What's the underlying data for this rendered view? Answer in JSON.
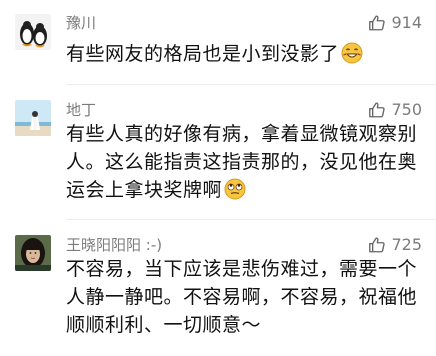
{
  "comments": [
    {
      "username": "豫川",
      "likes": "914",
      "text": "有些网友的格局也是小到没影了",
      "emoji": "grin-emoji"
    },
    {
      "username": "地丁",
      "likes": "750",
      "text": "有些人真的好像有病，拿着显微镜观察别人。这么能指责这指责那的，没见他在奥运会上拿块奖牌啊",
      "emoji": "rolling-eyes-emoji"
    },
    {
      "username": "王晓阳阳阳 :-)",
      "likes": "725",
      "text": "不容易，当下应该是悲伤难过，需要一个人静一静吧。不容易啊，不容易，祝福他顺顺利利、一切顺意～",
      "emoji": ""
    }
  ],
  "colors": {
    "username": "#7c7c7c",
    "like_count": "#7c7c7c",
    "thumb_icon": "#666666",
    "body_text": "#111111",
    "emoji_face": "#f7c641"
  },
  "icons": {
    "like": "thumbs-up-icon"
  }
}
